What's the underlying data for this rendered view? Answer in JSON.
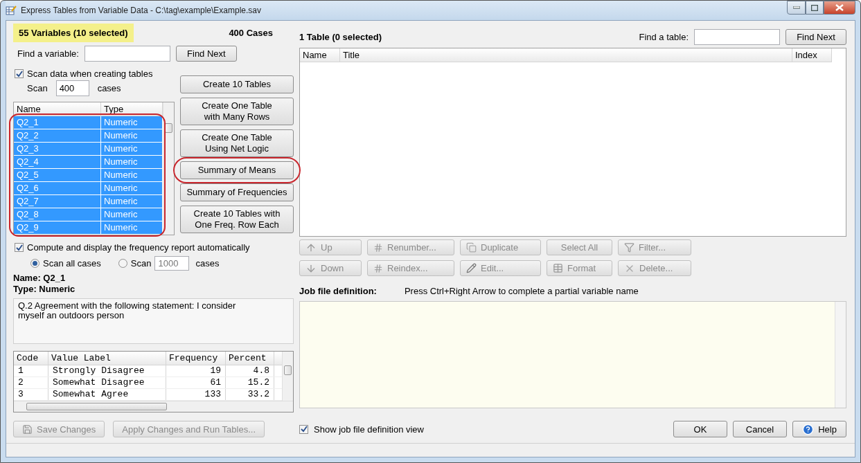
{
  "window": {
    "title": "Express Tables from Variable Data - C:\\tag\\example\\Example.sav"
  },
  "variables_panel": {
    "heading": "55 Variables  (10 selected)",
    "cases": "400 Cases",
    "find": {
      "label": "Find a variable:",
      "button": "Find Next"
    },
    "scan_option": {
      "label": "Scan data when creating tables",
      "checked": true
    },
    "scan": {
      "prefix": "Scan",
      "value": "400",
      "suffix": "cases"
    },
    "variable_list": {
      "highlighted": true,
      "columns": [
        "Name",
        "Type"
      ],
      "rows": [
        {
          "name": "Q2_1",
          "type": "Numeric",
          "selected": true
        },
        {
          "name": "Q2_2",
          "type": "Numeric",
          "selected": true
        },
        {
          "name": "Q2_3",
          "type": "Numeric",
          "selected": true
        },
        {
          "name": "Q2_4",
          "type": "Numeric",
          "selected": true
        },
        {
          "name": "Q2_5",
          "type": "Numeric",
          "selected": true
        },
        {
          "name": "Q2_6",
          "type": "Numeric",
          "selected": true
        },
        {
          "name": "Q2_7",
          "type": "Numeric",
          "selected": true
        },
        {
          "name": "Q2_8",
          "type": "Numeric",
          "selected": true
        },
        {
          "name": "Q2_9",
          "type": "Numeric",
          "selected": true
        }
      ]
    }
  },
  "create_buttons": [
    {
      "lines": [
        "Create 10 Tables"
      ],
      "highlighted": false
    },
    {
      "lines": [
        "Create One Table",
        "with Many Rows"
      ],
      "highlighted": false
    },
    {
      "lines": [
        "Create One Table",
        "Using Net Logic"
      ],
      "highlighted": false
    },
    {
      "lines": [
        "Summary of Means"
      ],
      "highlighted": true
    },
    {
      "lines": [
        "Summary of Frequencies"
      ],
      "highlighted": false
    },
    {
      "lines": [
        "Create 10 Tables with",
        "One Freq. Row Each"
      ],
      "highlighted": false
    }
  ],
  "frequency_report": {
    "checkbox": {
      "label": "Compute and display the frequency report automatically",
      "checked": true
    },
    "options": [
      {
        "label": "Scan all cases",
        "selected": true
      },
      {
        "label": "Scan",
        "selected": false
      }
    ],
    "count": "1000",
    "suffix": "cases"
  },
  "details": {
    "name": "Name: Q2_1",
    "type": "Type: Numeric",
    "description": "Q.2 Agreement with the following statement: I consider myself an outdoors person"
  },
  "frequency_table": {
    "columns": [
      "Code",
      "Value Label",
      "Frequency",
      "Percent"
    ],
    "rows": [
      [
        "1",
        "Strongly Disagree",
        "19",
        "4.8"
      ],
      [
        "2",
        "Somewhat Disagree",
        "61",
        "15.2"
      ],
      [
        "3",
        "Somewhat Agree",
        "133",
        "33.2"
      ]
    ]
  },
  "left_actions": [
    {
      "label": "Save Changes",
      "disabled": true
    },
    {
      "label": "Apply Changes and Run Tables...",
      "disabled": true
    }
  ],
  "tables_panel": {
    "heading": "1 Table  (0 selected)",
    "find": {
      "label": "Find a table:",
      "button": "Find Next"
    },
    "columns": [
      "Name",
      "Title",
      "Index"
    ]
  },
  "toolbar": [
    [
      {
        "label": "Up",
        "kind": "up",
        "disabled": true
      },
      {
        "label": "Renumber...",
        "kind": "numbers",
        "disabled": true
      },
      {
        "label": "Duplicate",
        "kind": "copy",
        "disabled": true
      },
      {
        "label": "Select All",
        "kind": "plain",
        "disabled": true
      },
      {
        "label": "Filter...",
        "kind": "filter",
        "disabled": true
      }
    ],
    [
      {
        "label": "Down",
        "kind": "down",
        "disabled": true
      },
      {
        "label": "Reindex...",
        "kind": "numbers",
        "disabled": true
      },
      {
        "label": "Edit...",
        "kind": "pencil",
        "disabled": true
      },
      {
        "label": "Format",
        "kind": "grid",
        "disabled": true
      },
      {
        "label": "Delete...",
        "kind": "delete",
        "disabled": true
      }
    ]
  ],
  "job_file": {
    "label": "Job file definition:",
    "hint": "Press Ctrl+Right Arrow to complete a partial variable name"
  },
  "show_view": {
    "label": "Show job file definition view",
    "checked": true
  },
  "dialog_buttons": [
    {
      "label": "OK"
    },
    {
      "label": "Cancel"
    },
    {
      "label": "Help"
    }
  ]
}
